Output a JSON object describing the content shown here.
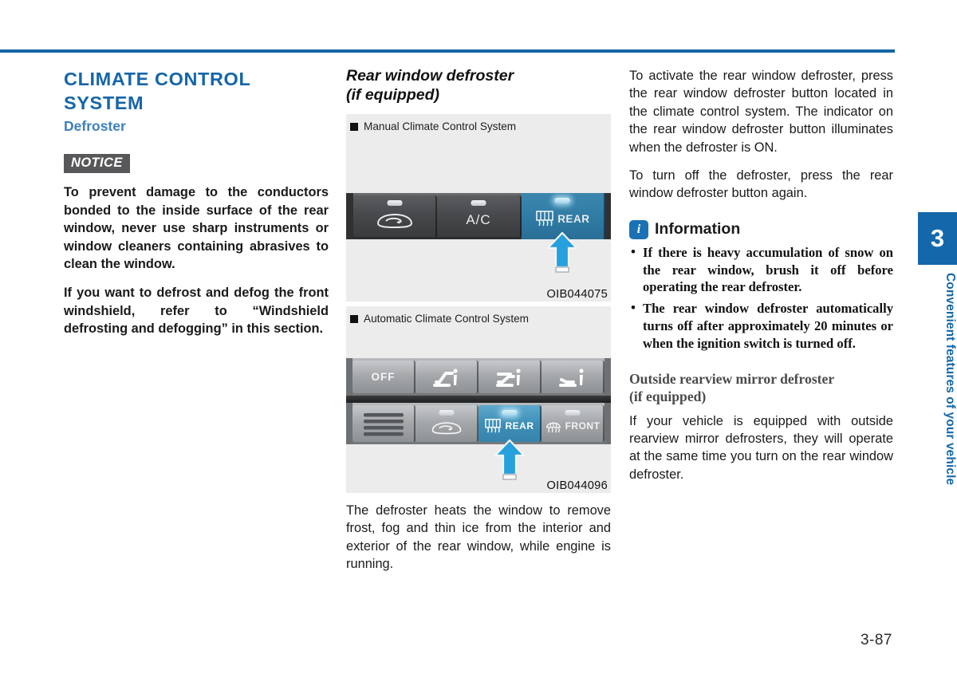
{
  "page": {
    "number": "3-87",
    "chapter_number": "3",
    "chapter_title": "Convenient features of your vehicle",
    "accent_color": "#1565a8"
  },
  "left_column": {
    "section_title": "CLIMATE CONTROL SYSTEM",
    "subsection_title": "Defroster",
    "notice_label": "NOTICE",
    "notice_paragraphs": [
      "To prevent damage to the conductors bonded to the inside surface of the rear window, never use sharp instruments or window cleaners containing abrasives to clean the window.",
      "If you want to defrost and defog the front windshield, refer to “Windshield defrosting and defogging” in this section."
    ]
  },
  "middle_column": {
    "heading": "Rear window defroster",
    "heading_sub": "(if equipped)",
    "figures": [
      {
        "label": "Manual Climate Control System",
        "code": "OIB044075",
        "buttons": [
          {
            "name": "air-recirculation",
            "text": "",
            "icon": "recirculation-icon",
            "state": "off"
          },
          {
            "name": "ac",
            "text": "A/C",
            "icon": "",
            "state": "off"
          },
          {
            "name": "rear-defroster",
            "text": "REAR",
            "icon": "rear-defroster-icon",
            "state": "on"
          }
        ],
        "callout": "arrow pointing at rear defroster button"
      },
      {
        "label": "Automatic Climate Control System",
        "code": "OIB044096",
        "top_row": [
          {
            "name": "off",
            "text": "OFF"
          },
          {
            "name": "mode-face",
            "text": ""
          },
          {
            "name": "mode-face-floor",
            "text": ""
          },
          {
            "name": "mode-floor",
            "text": ""
          }
        ],
        "bottom_row": [
          {
            "name": "blower",
            "text": "",
            "state": "off"
          },
          {
            "name": "air-recirculation",
            "text": "",
            "state": "off"
          },
          {
            "name": "rear-defroster",
            "text": "REAR",
            "state": "on"
          },
          {
            "name": "front-defroster",
            "text": "FRONT",
            "state": "off"
          }
        ],
        "callout": "arrow pointing at rear defroster button"
      }
    ],
    "body_paragraph": "The defroster heats the window to remove frost, fog and thin ice from the   interior and exterior of the rear window, while engine is running."
  },
  "right_column": {
    "paragraphs": [
      "To activate the rear window defroster, press the rear window defroster button located in the climate control system. The indicator on the rear window defroster button illuminates when the defroster is ON.",
      "To turn off the defroster, press the rear window defroster button again."
    ],
    "info_icon_glyph": "i",
    "info_title": "Information",
    "info_bullets": [
      "If there is heavy accumulation of snow on the rear window, brush it off before operating the rear defroster.",
      "The rear window defroster automatically turns off after approximately 20 minutes or when the ignition switch is turned off."
    ],
    "mirror_heading": "Outside rearview mirror defroster",
    "mirror_heading_sub": "(if equipped)",
    "mirror_paragraph": "If your vehicle is equipped with outside rearview mirror defrosters, they will operate at the same time you turn on the rear window defroster."
  }
}
